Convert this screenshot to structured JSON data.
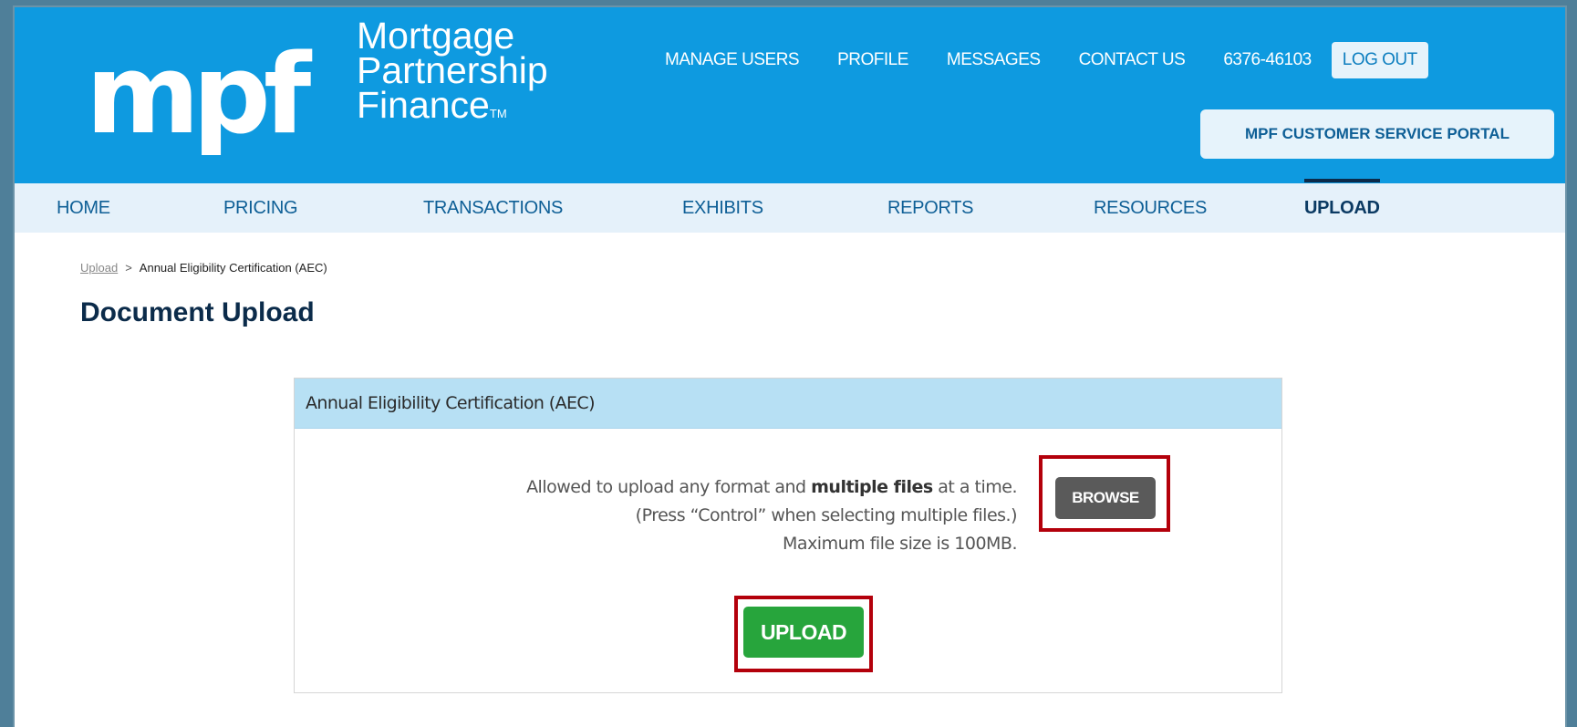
{
  "header": {
    "logo_mark": "mpf",
    "logo_lines": [
      "Mortgage",
      "Partnership",
      "Finance"
    ],
    "logo_tm": "TM",
    "top_nav": [
      "MANAGE USERS",
      "PROFILE",
      "MESSAGES",
      "CONTACT US"
    ],
    "account_number": "6376-46103",
    "logout_label": "LOG OUT",
    "portal_label": "MPF CUSTOMER SERVICE PORTAL"
  },
  "main_nav": {
    "items": [
      "HOME",
      "PRICING",
      "TRANSACTIONS",
      "EXHIBITS",
      "REPORTS",
      "RESOURCES",
      "UPLOAD"
    ],
    "active": "UPLOAD"
  },
  "breadcrumb": {
    "link": "Upload",
    "separator": ">",
    "current": "Annual Eligibility Certification (AEC)"
  },
  "page_title": "Document Upload",
  "panel": {
    "title": "Annual Eligibility Certification (AEC)",
    "line1_a": "Allowed to upload any format and ",
    "line1_bold": "multiple files",
    "line1_b": " at a time.",
    "line2": "(Press “Control” when selecting multiple files.)",
    "line3": "Maximum file size is 100MB.",
    "browse_label": "BROWSE",
    "upload_label": "UPLOAD"
  },
  "colors": {
    "header_blue": "#0e9ae0",
    "highlight_red": "#b3000b",
    "upload_green": "#27a53c",
    "browse_gray": "#5a5a5a"
  }
}
